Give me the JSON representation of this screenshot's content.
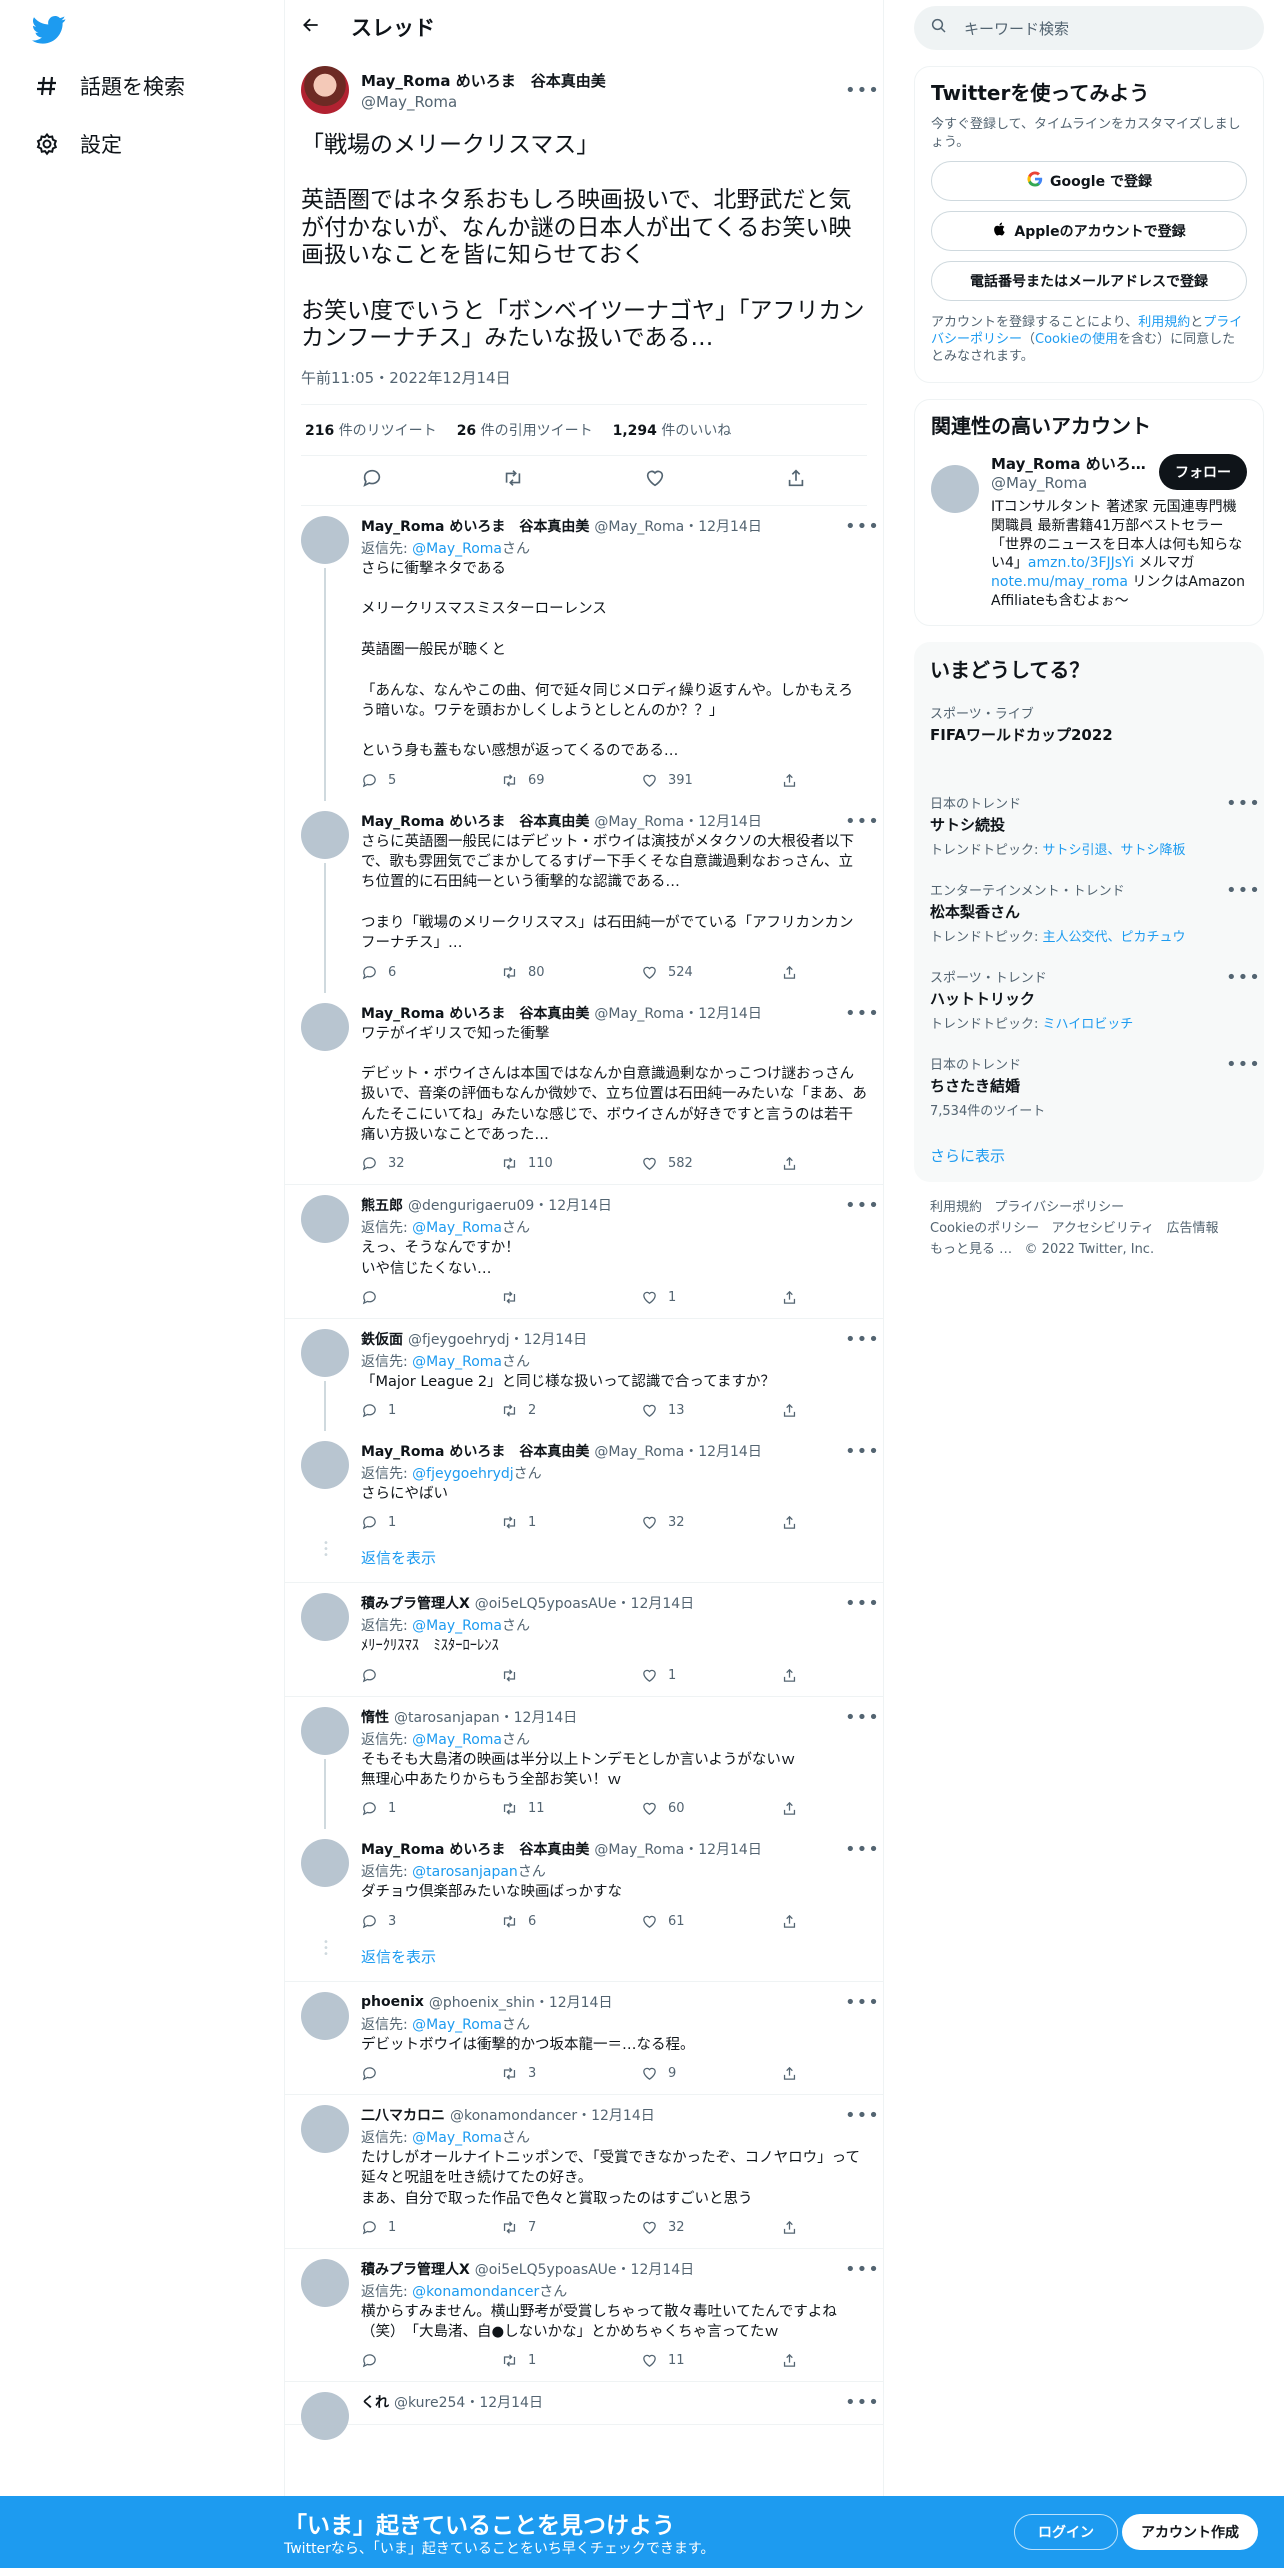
{
  "nav": {
    "explore": "話題を検索",
    "settings": "設定"
  },
  "header": {
    "title": "スレッド"
  },
  "focus_tweet": {
    "name": "May_Roma めいろま　谷本真由美",
    "handle": "@May_Roma",
    "text": "「戦場のメリークリスマス」\n\n英語圏ではネタ系おもしろ映画扱いで、北野武だと気が付かないが、なんか謎の日本人が出てくるお笑い映画扱いなことを皆に知らせておく\n\nお笑い度でいうと「ボンベイツーナゴヤ」「アフリカンカンフーナチス」みたいな扱いである…",
    "time": "午前11:05・2022年12月14日",
    "retweets": "216",
    "retweets_label": "件のリツイート",
    "quotes": "26",
    "quotes_label": "件の引用ツイート",
    "likes": "1,294",
    "likes_label": "件のいいね"
  },
  "tweets": [
    {
      "name": "May_Roma めいろま　谷本真由美",
      "meta": "@May_Roma・12月14日",
      "reply_prefix": "返信先: ",
      "reply_to": "@May_Roma",
      "reply_suffix": "さん",
      "text": "さらに衝撃ネタである\n\nメリークリスマスミスターローレンス\n\n英語圏一般民が聴くと\n\n「あんな、なんやこの曲、何で延々同じメロディ繰り返すんや。しかもえろう暗いな。ワテを頭おかしくしようとしとんのか？？」\n\nという身も蓋もない感想が返ってくるのである…",
      "replies": "5",
      "rts": "69",
      "likes": "391"
    },
    {
      "name": "May_Roma めいろま　谷本真由美",
      "meta": "@May_Roma・12月14日",
      "text": "さらに英語圏一般民にはデビット・ボウイは演技がメタクソの大根役者以下で、歌も雰囲気でごまかしてるすげー下手くそな自意識過剰なおっさん、立ち位置的に石田純一という衝撃的な認識である…\n\nつまり「戦場のメリークリスマス」は石田純一がでている「アフリカンカンフーナチス」…",
      "replies": "6",
      "rts": "80",
      "likes": "524"
    },
    {
      "name": "May_Roma めいろま　谷本真由美",
      "meta": "@May_Roma・12月14日",
      "text": "ワテがイギリスで知った衝撃\n\nデビット・ボウイさんは本国ではなんか自意識過剰なかっこつけ謎おっさん扱いで、音楽の評価もなんか微妙で、立ち位置は石田純一みたいな「まあ、あんたそこにいてね」みたいな感じで、ボウイさんが好きですと言うのは若干痛い方扱いなことであった…",
      "replies": "32",
      "rts": "110",
      "likes": "582"
    },
    {
      "name": "熊五郎",
      "meta": "@dengurigaeru09・12月14日",
      "reply_prefix": "返信先: ",
      "reply_to": "@May_Roma",
      "reply_suffix": "さん",
      "text": "えっ、そうなんですか！\nいや信じたくない…",
      "replies": "",
      "rts": "",
      "likes": "1"
    },
    {
      "name": "鉄仮面",
      "meta": "@fjeygoehrydj・12月14日",
      "reply_prefix": "返信先: ",
      "reply_to": "@May_Roma",
      "reply_suffix": "さん",
      "text": "「Major League 2」と同じ様な扱いって認識で合ってますか？",
      "replies": "1",
      "rts": "2",
      "likes": "13"
    },
    {
      "name": "May_Roma めいろま　谷本真由美",
      "meta": "@May_Roma・12月14日",
      "reply_prefix": "返信先: ",
      "reply_to": "@fjeygoehrydj",
      "reply_suffix": "さん",
      "text": "さらにやばい",
      "replies": "1",
      "rts": "1",
      "likes": "32"
    },
    {
      "name": "積みプラ管理人X",
      "meta": "@oi5eLQ5ypoasAUe・12月14日",
      "reply_prefix": "返信先: ",
      "reply_to": "@May_Roma",
      "reply_suffix": "さん",
      "text": "ﾒﾘｰｸﾘｽﾏｽ　ﾐｽﾀｰﾛｰﾚﾝｽ",
      "replies": "",
      "rts": "",
      "likes": "1"
    },
    {
      "name": "惰性",
      "meta": "@tarosanjapan・12月14日",
      "reply_prefix": "返信先: ",
      "reply_to": "@May_Roma",
      "reply_suffix": "さん",
      "text": "そもそも大島渚の映画は半分以上トンデモとしか言いようがないｗ\n無理心中あたりからもう全部お笑い！ｗ",
      "replies": "1",
      "rts": "11",
      "likes": "60"
    },
    {
      "name": "May_Roma めいろま　谷本真由美",
      "meta": "@May_Roma・12月14日",
      "reply_prefix": "返信先: ",
      "reply_to": "@tarosanjapan",
      "reply_suffix": "さん",
      "text": "ダチョウ倶楽部みたいな映画ばっかすな",
      "replies": "3",
      "rts": "6",
      "likes": "61"
    },
    {
      "name": "phoenix",
      "meta": "@phoenix_shin・12月14日",
      "reply_prefix": "返信先: ",
      "reply_to": "@May_Roma",
      "reply_suffix": "さん",
      "text": "デビットボウイは衝撃的かつ坂本龍一＝…なる程。",
      "replies": "",
      "rts": "3",
      "likes": "9"
    },
    {
      "name": "二八マカロニ",
      "meta": "@konamondancer・12月14日",
      "reply_prefix": "返信先: ",
      "reply_to": "@May_Roma",
      "reply_suffix": "さん",
      "text": "たけしがオールナイトニッポンで、「受賞できなかったぞ、コノヤロウ」って延々と呪詛を吐き続けてたの好き。\nまあ、自分で取った作品で色々と賞取ったのはすごいと思う",
      "replies": "1",
      "rts": "7",
      "likes": "32"
    },
    {
      "name": "積みプラ管理人X",
      "meta": "@oi5eLQ5ypoasAUe・12月14日",
      "reply_prefix": "返信先: ",
      "reply_to": "@konamondancer",
      "reply_suffix": "さん",
      "text": "横からすみません。横山野考が受賞しちゃって散々毒吐いてたんですよね（笑）　「大島渚、自●しないかな」とかめちゃくちゃ言ってたｗ",
      "replies": "",
      "rts": "1",
      "likes": "11"
    },
    {
      "name": "くれ",
      "meta": "@kure254・12月14日",
      "text": "",
      "replies": "",
      "rts": "",
      "likes": ""
    }
  ],
  "show_replies": "返信を表示",
  "right": {
    "search_placeholder": "キーワード検索",
    "signup": {
      "title": "Twitterを使ってみよう",
      "sub": "今すぐ登録して、タイムラインをカスタマイズしましょう。",
      "google": "Google で登録",
      "apple": "Appleのアカウントで登録",
      "phone": "電話番号またはメールアドレスで登録",
      "legal_1": "アカウントを登録することにより、",
      "legal_terms": "利用規約",
      "legal_2": "と",
      "legal_privacy": "プライバシーポリシー",
      "legal_3": "（",
      "legal_cookie": "Cookieの使用",
      "legal_4": "を含む）に同意したとみなされます。"
    },
    "relevant": {
      "title": "関連性の高いアカウント",
      "name": "May_Roma めいろま…",
      "handle": "@May_Roma",
      "follow": "フォロー",
      "bio_1": "ITコンサルタント 著述家 元国連専門機関職員 最新書籍41万部ベストセラー「世界のニュースを日本人は何も知らない4」",
      "bio_link1": "amzn.to/3FJJsYi",
      "bio_2": " メルマガ",
      "bio_link2": "note.mu/may_roma",
      "bio_3": " リンクはAmazon Affiliateも含むよぉ〜"
    },
    "trends": {
      "title": "いまどうしてる？",
      "items": [
        {
          "ctx": "スポーツ・ライブ",
          "title": "FIFAワールドカップ2022",
          "ex_label": "",
          "ex": ""
        },
        {
          "ctx": "日本のトレンド",
          "title": "サトシ続投",
          "ex_label": "トレンドトピック: ",
          "ex": "サトシ引退、サトシ降板"
        },
        {
          "ctx": "エンターテインメント・トレンド",
          "title": "松本梨香さん",
          "ex_label": "トレンドトピック: ",
          "ex": "主人公交代、ピカチュウ"
        },
        {
          "ctx": "スポーツ・トレンド",
          "title": "ハットトリック",
          "ex_label": "トレンドトピック: ",
          "ex": "ミハイロビッチ"
        },
        {
          "ctx": "日本のトレンド",
          "title": "ちさたき結婚",
          "ex_label": "",
          "ex": "7,534件のツイート"
        }
      ],
      "show_more": "さらに表示"
    },
    "footer": {
      "l1": "利用規約",
      "l2": "プライバシーポリシー",
      "l3": "Cookieのポリシー",
      "l4": "アクセシビリティ",
      "l5": "広告情報",
      "l6": "もっと見る …",
      "l7": "© 2022 Twitter, Inc."
    }
  },
  "bottombar": {
    "title": "「いま」起きていることを見つけよう",
    "sub": "Twitterなら、「いま」起きていることをいち早くチェックできます。",
    "login": "ログイン",
    "signup": "アカウント作成"
  },
  "colors": {
    "accent": "#1d9bf0",
    "text": "#0f1419",
    "muted": "#536471"
  }
}
